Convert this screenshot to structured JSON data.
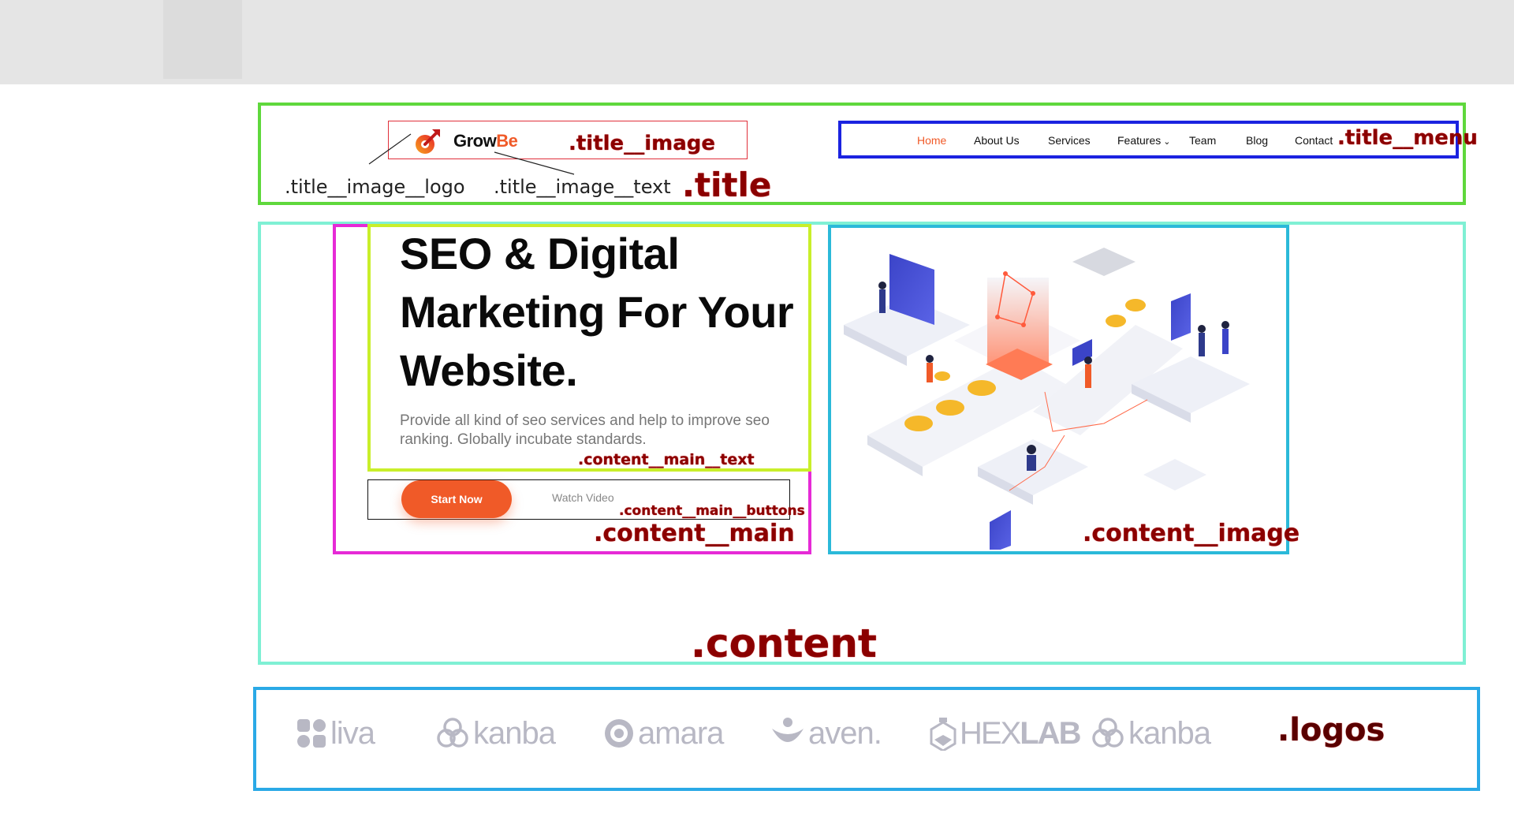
{
  "header": {
    "brand_main": "Grow",
    "brand_accent": "Be",
    "menu": [
      "Home",
      "About Us",
      "Services",
      "Features",
      "Team",
      "Blog",
      "Contact"
    ],
    "features_caret": "⌄"
  },
  "hero": {
    "headline_line1": "SEO & Digital",
    "headline_line2": "Marketing For Your",
    "headline_line3": "Website.",
    "subtext": "Provide all kind of seo services and help to improve seo ranking. Globally incubate standards.",
    "start_button": "Start Now",
    "watch_button": "Watch Video"
  },
  "logos": [
    "liva",
    "kanba",
    "amara",
    "aven.",
    "HEX",
    "LAB",
    "kanba"
  ],
  "annotations": {
    "title": ".title",
    "title_image": ".title__image",
    "title_image_logo": ".title__image__logo",
    "title_image_text": ".title__image__text",
    "title_menu": ".title__menu",
    "content": ".content",
    "content_main": ".content__main",
    "content_main_text": ".content__main__text",
    "content_main_buttons": ".content__main__buttons",
    "content_image": ".content__image",
    "logos": ".logos"
  },
  "colors": {
    "accent": "#f05a28",
    "logo_gray": "#b8b8c4"
  }
}
